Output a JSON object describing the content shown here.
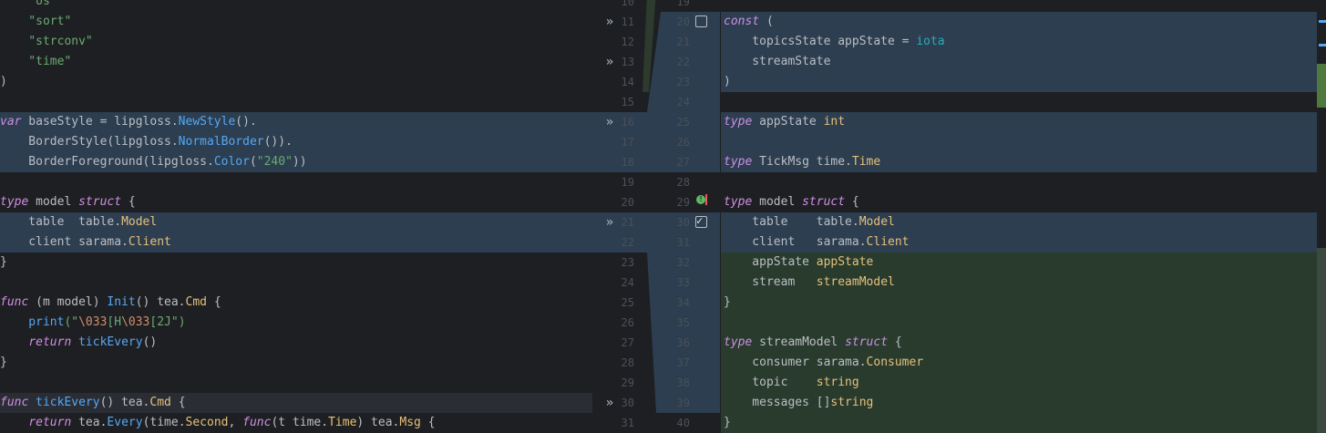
{
  "colors": {
    "modified": "#2c3e4f",
    "added": "#283b2d",
    "ribbon_mod": "#2c3e4f",
    "ribbon_add": "#283b2d"
  },
  "left_lines": [
    {
      "tokens": [
        [
          "    \"os\"",
          "s"
        ]
      ]
    },
    {
      "tokens": [
        [
          "    \"sort\"",
          "s"
        ]
      ]
    },
    {
      "tokens": [
        [
          "    \"strconv\"",
          "s"
        ]
      ]
    },
    {
      "tokens": [
        [
          "    \"time\"",
          "s"
        ]
      ]
    },
    {
      "tokens": [
        [
          ")",
          "t"
        ]
      ]
    },
    {
      "tokens": []
    },
    {
      "tokens": [
        [
          "var",
          "k"
        ],
        [
          " baseStyle = lipgloss.",
          "t"
        ],
        [
          "NewStyle",
          "fn"
        ],
        [
          "().",
          "t"
        ]
      ],
      "bg": "mod"
    },
    {
      "tokens": [
        [
          "    BorderStyle(lipgloss.",
          "t"
        ],
        [
          "NormalBorder",
          "fn"
        ],
        [
          "()).",
          "t"
        ]
      ],
      "bg": "mod"
    },
    {
      "tokens": [
        [
          "    BorderForeground(lipgloss.",
          "t"
        ],
        [
          "Color",
          "fn"
        ],
        [
          "(",
          "t"
        ],
        [
          "\"240\"",
          "s"
        ],
        [
          "))",
          "t"
        ]
      ],
      "bg": "mod"
    },
    {
      "tokens": []
    },
    {
      "tokens": [
        [
          "type",
          "k"
        ],
        [
          " model ",
          "t"
        ],
        [
          "struct",
          "k"
        ],
        [
          " {",
          "t"
        ]
      ]
    },
    {
      "tokens": [
        [
          "    table  table.",
          "t"
        ],
        [
          "Model",
          "ty"
        ]
      ],
      "bg": "mod"
    },
    {
      "tokens": [
        [
          "    client sarama.",
          "t"
        ],
        [
          "Client",
          "ty"
        ]
      ],
      "bg": "mod"
    },
    {
      "tokens": [
        [
          "}",
          "t"
        ]
      ]
    },
    {
      "tokens": []
    },
    {
      "tokens": [
        [
          "func",
          "k"
        ],
        [
          " (m model) ",
          "t"
        ],
        [
          "Init",
          "fn"
        ],
        [
          "() tea.",
          "t"
        ],
        [
          "Cmd",
          "ty"
        ],
        [
          " {",
          "t"
        ]
      ]
    },
    {
      "tokens": [
        [
          "    print",
          "fn"
        ],
        [
          "(\"",
          "s"
        ],
        [
          "\\033",
          "esc"
        ],
        [
          "[H",
          "s"
        ],
        [
          "\\033",
          "esc"
        ],
        [
          "[2J\")",
          "s"
        ]
      ]
    },
    {
      "tokens": [
        [
          "    ",
          "t"
        ],
        [
          "return",
          "k"
        ],
        [
          " ",
          "t"
        ],
        [
          "tickEvery",
          "fn"
        ],
        [
          "()",
          "t"
        ]
      ]
    },
    {
      "tokens": [
        [
          "}",
          "t"
        ]
      ]
    },
    {
      "tokens": []
    },
    {
      "tokens": [
        [
          "func",
          "k"
        ],
        [
          " ",
          "t"
        ],
        [
          "tickEvery",
          "fn"
        ],
        [
          "() tea.",
          "t"
        ],
        [
          "Cmd",
          "ty"
        ],
        [
          " {",
          "t"
        ]
      ],
      "bg": "dim"
    },
    {
      "tokens": [
        [
          "    ",
          "t"
        ],
        [
          "return",
          "k"
        ],
        [
          " tea.",
          "t"
        ],
        [
          "Every",
          "fn"
        ],
        [
          "(time.",
          "t"
        ],
        [
          "Second",
          "ty"
        ],
        [
          ", ",
          "t"
        ],
        [
          "func",
          "k"
        ],
        [
          "(t time.",
          "t"
        ],
        [
          "Time",
          "ty"
        ],
        [
          ") tea.",
          "t"
        ],
        [
          "Msg",
          "ty"
        ],
        [
          " {",
          "t"
        ]
      ]
    }
  ],
  "right_lines": [
    {
      "tokens": []
    },
    {
      "tokens": [
        [
          "const",
          "k"
        ],
        [
          " (",
          "t"
        ]
      ],
      "bg": "mod"
    },
    {
      "tokens": [
        [
          "    topicsState appState = ",
          "t"
        ],
        [
          "iota",
          "num"
        ]
      ],
      "bg": "mod"
    },
    {
      "tokens": [
        [
          "    streamState",
          "t"
        ]
      ],
      "bg": "mod"
    },
    {
      "tokens": [
        [
          ")",
          "t"
        ]
      ],
      "bg": "mod"
    },
    {
      "tokens": []
    },
    {
      "tokens": [
        [
          "type",
          "k"
        ],
        [
          " appState ",
          "t"
        ],
        [
          "int",
          "ty"
        ]
      ],
      "bg": "mod"
    },
    {
      "tokens": [],
      "bg": "mod"
    },
    {
      "tokens": [
        [
          "type",
          "k"
        ],
        [
          " TickMsg time.",
          "t"
        ],
        [
          "Time",
          "ty"
        ]
      ],
      "bg": "mod"
    },
    {
      "tokens": []
    },
    {
      "tokens": [
        [
          "type",
          "k"
        ],
        [
          " model ",
          "t"
        ],
        [
          "struct",
          "k"
        ],
        [
          " {",
          "t"
        ]
      ]
    },
    {
      "tokens": [
        [
          "    table    table.",
          "t"
        ],
        [
          "Model",
          "ty"
        ]
      ],
      "bg": "mod"
    },
    {
      "tokens": [
        [
          "    client   sarama.",
          "t"
        ],
        [
          "Client",
          "ty"
        ]
      ],
      "bg": "mod"
    },
    {
      "tokens": [
        [
          "    appState ",
          "t"
        ],
        [
          "appState",
          "ty"
        ]
      ],
      "bg": "add"
    },
    {
      "tokens": [
        [
          "    stream   ",
          "t"
        ],
        [
          "streamModel",
          "ty"
        ]
      ],
      "bg": "add"
    },
    {
      "tokens": [
        [
          "}",
          "t"
        ]
      ],
      "bg": "add"
    },
    {
      "tokens": [],
      "bg": "add"
    },
    {
      "tokens": [
        [
          "type",
          "k"
        ],
        [
          " streamModel ",
          "t"
        ],
        [
          "struct",
          "k"
        ],
        [
          " {",
          "t"
        ]
      ],
      "bg": "add"
    },
    {
      "tokens": [
        [
          "    consumer sarama.",
          "t"
        ],
        [
          "Consumer",
          "ty"
        ]
      ],
      "bg": "add"
    },
    {
      "tokens": [
        [
          "    topic    ",
          "t"
        ],
        [
          "string",
          "ty"
        ]
      ],
      "bg": "add"
    },
    {
      "tokens": [
        [
          "    messages []",
          "t"
        ],
        [
          "string",
          "ty"
        ]
      ],
      "bg": "add"
    },
    {
      "tokens": [
        [
          "}",
          "t"
        ]
      ],
      "bg": "add"
    }
  ],
  "left_numbers": [
    "10",
    "11",
    "12",
    "13",
    "14",
    "15",
    "16",
    "17",
    "18",
    "19",
    "20",
    "21",
    "22",
    "23",
    "24",
    "25",
    "26",
    "27",
    "28",
    "29",
    "30",
    "31"
  ],
  "right_numbers": [
    "19",
    "20",
    "21",
    "22",
    "23",
    "24",
    "25",
    "26",
    "27",
    "28",
    "29",
    "30",
    "31",
    "32",
    "33",
    "34",
    "35",
    "36",
    "37",
    "38",
    "39",
    "40"
  ],
  "chevrons": [
    1,
    3,
    6,
    11,
    20
  ],
  "checkboxes": [
    {
      "row": 1,
      "checked": false
    },
    {
      "row": 11,
      "checked": true
    }
  ]
}
